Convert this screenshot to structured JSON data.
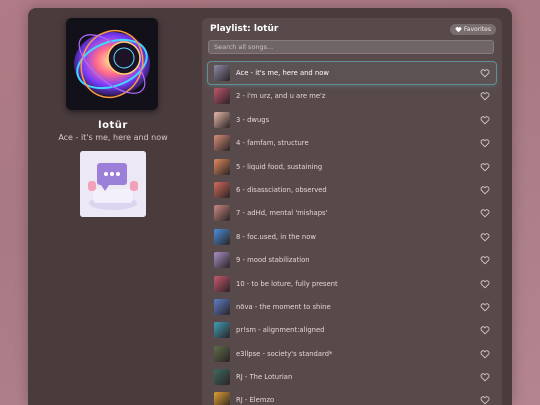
{
  "artist": "lotür",
  "now_playing": "Ace - it's me, here and now",
  "playlist": {
    "title": "Playlist: lotür",
    "favorites_label": "Favorites",
    "search_placeholder": "Search all songs...",
    "tracks": [
      {
        "title": "Ace - it's me, here and now",
        "active": true,
        "color": "#8b8aa8"
      },
      {
        "title": "2 - i'm urz, and u are me'z",
        "color": "#c0566b"
      },
      {
        "title": "3 - dwugs",
        "color": "#e6b8a8"
      },
      {
        "title": "4 - famfam, structure",
        "color": "#d68f78"
      },
      {
        "title": "5 - liquid food, sustaining",
        "color": "#e08a5c"
      },
      {
        "title": "6 - disassciation, observed",
        "color": "#d46a5d"
      },
      {
        "title": "7 - adHd, mental 'mishaps'",
        "color": "#c98a82"
      },
      {
        "title": "8 - foc.used, in the now",
        "color": "#4a90d9"
      },
      {
        "title": "9 - mood stabilization",
        "color": "#a990c2"
      },
      {
        "title": "10 - to be loture, fully present",
        "color": "#c85a70"
      },
      {
        "title": "nōva - the moment to shine",
        "color": "#5e7fc7"
      },
      {
        "title": "pr!sm - alignment:aligned",
        "color": "#3f9fb5"
      },
      {
        "title": "e3llpse - society's standard*",
        "color": "#5f6d47"
      },
      {
        "title": "RJ - The Loturian",
        "color": "#3d6b5f"
      },
      {
        "title": "RJ - Elemzo",
        "color": "#e0a030"
      }
    ]
  }
}
